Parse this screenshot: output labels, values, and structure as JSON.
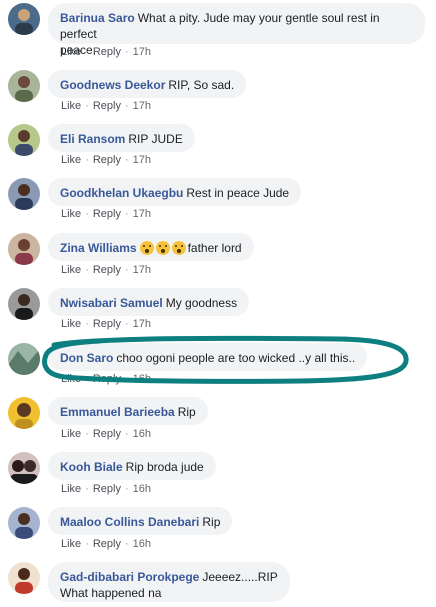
{
  "comments": [
    {
      "author": "Barinua Saro",
      "text_line1": "What a pity. Jude may your gentle soul rest in perfect",
      "text_line2": "peace.",
      "like": "Like",
      "reply": "Reply",
      "time": "17h",
      "avatar_color": "#4a6b8a"
    },
    {
      "author": "Goodnews Deekor",
      "text": "RIP, So sad.",
      "like": "Like",
      "reply": "Reply",
      "time": "17h",
      "avatar_color": "#7a8a6a"
    },
    {
      "author": "Eli Ransom",
      "text": "RIP JUDE",
      "like": "Like",
      "reply": "Reply",
      "time": "17h",
      "avatar_color": "#8aa56a"
    },
    {
      "author": "Goodkhelan Ukaegbu",
      "text": "Rest in peace Jude",
      "like": "Like",
      "reply": "Reply",
      "time": "17h",
      "avatar_color": "#6b7b9a"
    },
    {
      "author": "Zina Williams",
      "text": "father lord",
      "emoji_icons": [
        "face-astonished-icon",
        "face-astonished-icon",
        "face-astonished-icon"
      ],
      "like": "Like",
      "reply": "Reply",
      "time": "17h",
      "avatar_color": "#9a8a7a"
    },
    {
      "author": "Nwisabari Samuel",
      "text": "My goodness",
      "like": "Like",
      "reply": "Reply",
      "time": "17h",
      "avatar_color": "#5a5a5a"
    },
    {
      "author": "Don Saro",
      "text": "choo ogoni people are too wicked ..y all this..",
      "like": "Like",
      "reply": "Reply",
      "time": "16h",
      "avatar_color": "#6a8a7a"
    },
    {
      "author": "Emmanuel Barieeba",
      "text": "Rip",
      "like": "Like",
      "reply": "Reply",
      "time": "16h",
      "avatar_color": "#e0b020"
    },
    {
      "author": "Kooh Biale",
      "text": "Rip broda jude",
      "like": "Like",
      "reply": "Reply",
      "time": "16h",
      "avatar_color": "#3a2a2a"
    },
    {
      "author": "Maaloo Collins Danebari",
      "text": "Rip",
      "like": "Like",
      "reply": "Reply",
      "time": "16h",
      "avatar_color": "#7a8aa5"
    },
    {
      "author": "Gad-dibabari Porokpege",
      "text_line1": "Jeeeez.....RIP",
      "text_line2": "What happened na",
      "avatar_color": "#c0392b"
    }
  ],
  "colors": {
    "author": "#385898",
    "bubble": "#f2f3f5",
    "highlight_stroke": "#0e7f80",
    "meta": "#606770"
  }
}
